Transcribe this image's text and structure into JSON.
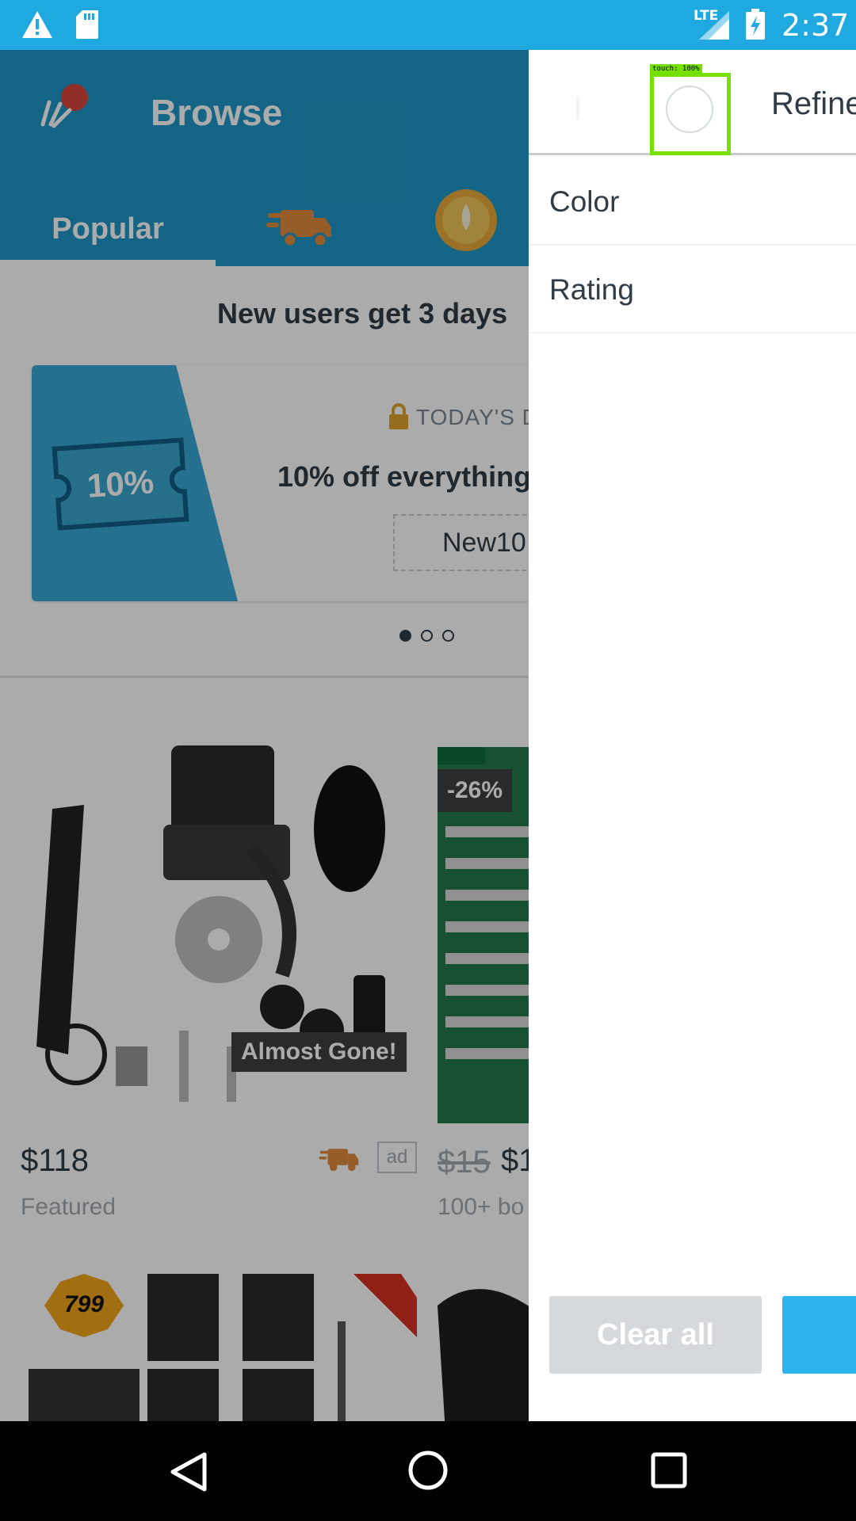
{
  "status_bar": {
    "network": "LTE",
    "time": "2:37",
    "icons": [
      "warning-icon",
      "sd-card-icon",
      "signal-icon",
      "battery-charging-icon"
    ]
  },
  "app_bar": {
    "title": "Browse",
    "tabs": [
      {
        "label": "Popular",
        "selected": true
      },
      {
        "icon": "fast-delivery-truck-icon"
      },
      {
        "icon": "gold-coin-icon"
      }
    ]
  },
  "promo": {
    "banner_text": "New users get 3 days",
    "ticket_text": "10%",
    "deal_label": "TODAY'S D",
    "offer": "10% off everything",
    "code": "New10",
    "carousel_pages": 3,
    "carousel_active": 1
  },
  "products": [
    {
      "badge": "Almost Gone!",
      "price": "$118",
      "caption": "Featured",
      "ad_label": "ad"
    },
    {
      "discount": "-26%",
      "old_price": "$15",
      "price": "$1",
      "caption": "100+ bo"
    }
  ],
  "drawer": {
    "title": "Refine",
    "filters": [
      "Color",
      "Rating"
    ],
    "clear_all": "Clear all"
  },
  "touch_overlay": {
    "label": "touch: 100%"
  },
  "colors": {
    "status_bar": "#1fa9e0",
    "app_bar": "#1f97c6",
    "accent_blue": "#2fb3ec",
    "text_dark": "#2f3b46",
    "text_muted": "#a1a9b0",
    "touch_highlight": "#76e000"
  }
}
